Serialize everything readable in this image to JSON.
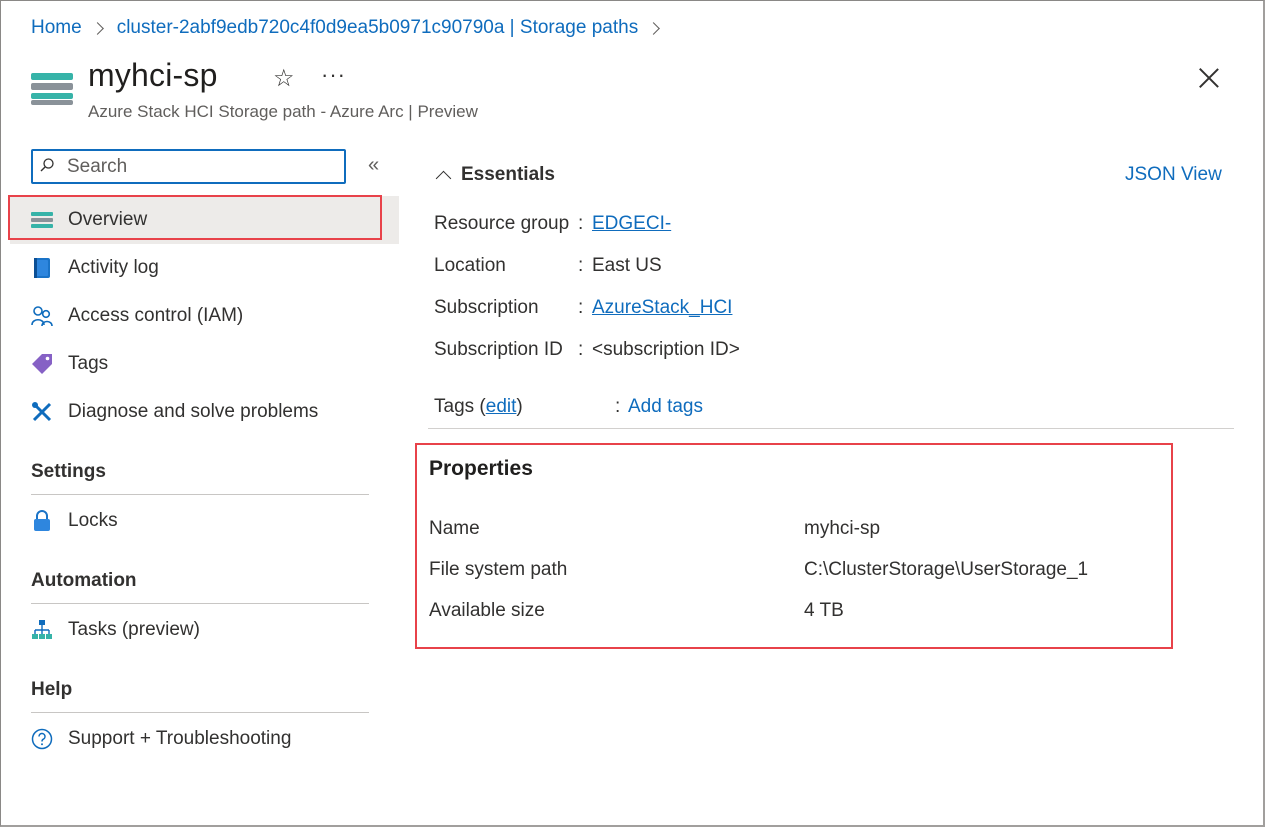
{
  "breadcrumb": {
    "home": "Home",
    "cluster": "cluster-2abf9edb720c4f0d9ea5b0971c90790a | Storage paths"
  },
  "header": {
    "title": "myhci-sp",
    "subtitle": "Azure Stack HCI Storage path - Azure Arc | Preview",
    "more_label": "···"
  },
  "search": {
    "placeholder": "Search"
  },
  "sidebar": {
    "items": [
      {
        "label": "Overview",
        "icon": "storage-path-icon",
        "active": true
      },
      {
        "label": "Activity log",
        "icon": "activity-log-icon"
      },
      {
        "label": "Access control (IAM)",
        "icon": "people-icon"
      },
      {
        "label": "Tags",
        "icon": "tag-icon"
      },
      {
        "label": "Diagnose and solve problems",
        "icon": "wrench-icon"
      }
    ],
    "sections": [
      {
        "title": "Settings",
        "items": [
          {
            "label": "Locks",
            "icon": "lock-icon"
          }
        ]
      },
      {
        "title": "Automation",
        "items": [
          {
            "label": "Tasks (preview)",
            "icon": "tasks-icon"
          }
        ]
      },
      {
        "title": "Help",
        "items": [
          {
            "label": "Support + Troubleshooting",
            "icon": "help-icon"
          }
        ]
      }
    ]
  },
  "essentials": {
    "title": "Essentials",
    "json_view": "JSON View",
    "rows": [
      {
        "key": "Resource group",
        "value": "EDGECI-",
        "is_link": true
      },
      {
        "key": "Location",
        "value": "East US",
        "is_link": false
      },
      {
        "key": "Subscription",
        "value": "AzureStack_HCI",
        "is_link": true
      },
      {
        "key": "Subscription ID",
        "value": "<subscription ID>",
        "is_link": false
      }
    ],
    "tags": {
      "label_prefix": "Tags (",
      "edit": "edit",
      "label_suffix": ")",
      "separator": ":",
      "add": "Add tags"
    }
  },
  "properties": {
    "title": "Properties",
    "rows": [
      {
        "key": "Name",
        "value": "myhci-sp"
      },
      {
        "key": "File system path",
        "value": "C:\\ClusterStorage\\UserStorage_1"
      },
      {
        "key": "Available size",
        "value": "4 TB"
      }
    ]
  },
  "colors": {
    "link": "#0f6cbd",
    "highlight": "#e8424a",
    "active_bg": "#edebe9",
    "resource_icon_teal": "#36b3a8",
    "resource_icon_gray": "#8a9299"
  }
}
